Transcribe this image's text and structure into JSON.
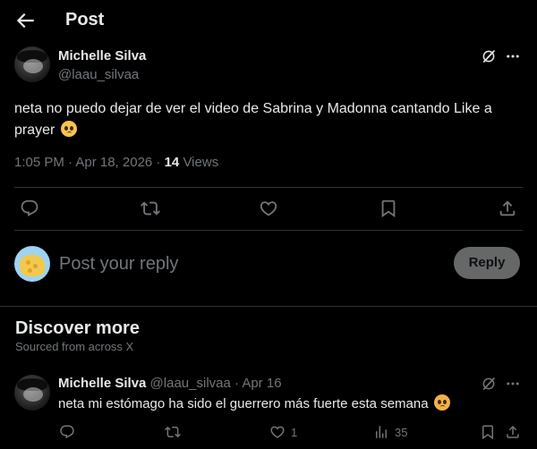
{
  "header": {
    "title": "Post",
    "back_icon": "arrow-left-icon"
  },
  "post": {
    "author_name": "Michelle Silva",
    "handle": "@laau_silvaa",
    "text": "neta no puedo dejar de ver el video de Sabrina y Madonna cantando Like a prayer",
    "emoji": "pleading-face",
    "time": "1:05 PM · Apr 18, 2026 · ",
    "views_count": "14",
    "views_label": " Views",
    "actions": [
      "reply-icon",
      "retweet-icon",
      "like-icon",
      "bookmark-icon",
      "share-icon"
    ]
  },
  "compose": {
    "placeholder": "Post your reply",
    "button_label": "Reply"
  },
  "discover": {
    "title": "Discover more",
    "subtitle": "Sourced from across X",
    "items": [
      {
        "author_name": "Michelle Silva",
        "handle_date": " @laau_silvaa · Apr 16",
        "text": "neta mi estómago ha sido el guerrero más fuerte esta semana",
        "emoji": "flushed-face",
        "reply_count": "",
        "retweet_count": "",
        "like_count": "1",
        "views_count": "35"
      }
    ]
  },
  "colors": {
    "background": "#000000",
    "text": "#e7e9ea",
    "muted": "#71767b",
    "divider": "#2f3336",
    "reply_button": "#787a7a"
  }
}
